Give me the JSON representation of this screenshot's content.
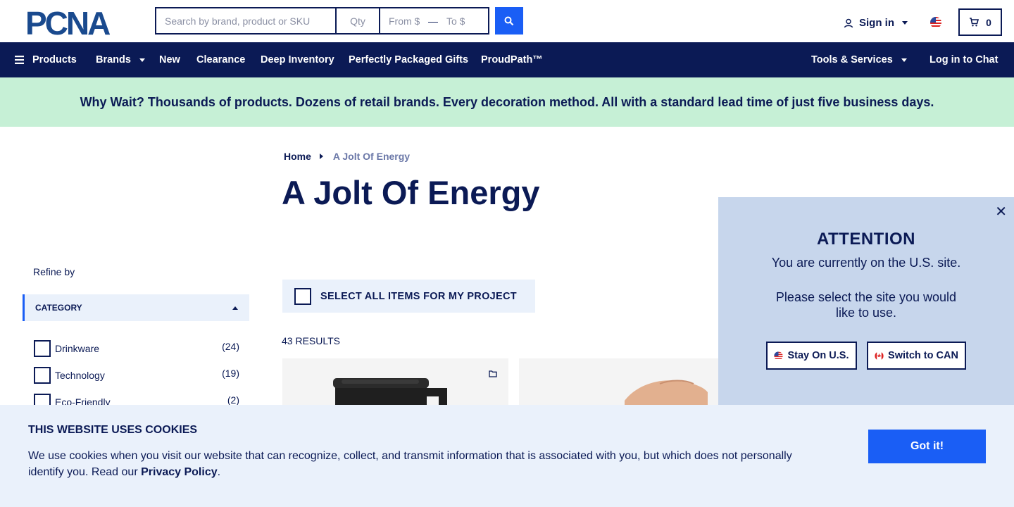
{
  "header": {
    "logo_text": "PCNA",
    "search_placeholder": "Search by brand, product or SKU",
    "qty_placeholder": "Qty",
    "from_placeholder": "From $",
    "to_placeholder": "To $",
    "signin_label": "Sign in",
    "cart_count": "0"
  },
  "nav": {
    "products": "Products",
    "brands": "Brands",
    "new": "New",
    "clearance": "Clearance",
    "deep_inventory": "Deep Inventory",
    "gifts": "Perfectly Packaged Gifts",
    "proudpath": "ProudPath™",
    "tools": "Tools & Services",
    "chat": "Log in to Chat"
  },
  "promo": "Why Wait? Thousands of products. Dozens of retail brands. Every decoration method. All with a standard lead time of just five business days.",
  "breadcrumb": {
    "home": "Home",
    "current": "A Jolt Of Energy"
  },
  "page_title": "A Jolt Of Energy",
  "sidebar": {
    "refine_label": "Refine by",
    "category_header": "CATEGORY",
    "categories": [
      {
        "label": "Drinkware",
        "count": "(24)"
      },
      {
        "label": "Technology",
        "count": "(19)"
      },
      {
        "label": "Eco-Friendly",
        "count": "(2)"
      }
    ]
  },
  "listing": {
    "select_all_label": "SELECT ALL ITEMS FOR MY PROJECT",
    "results_count": "43 RESULTS"
  },
  "attention": {
    "title": "ATTENTION",
    "line1": "You are currently on the U.S. site.",
    "line2": "Please select the site you would like to use.",
    "stay_label": "Stay On U.S.",
    "switch_label": "Switch to CAN"
  },
  "cookie": {
    "title": "THIS WEBSITE USES COOKIES",
    "text": "We use cookies when you visit our website that can recognize, collect, and transmit information that is associated with you, but which does not personally identify you. Read our ",
    "link": "Privacy Policy",
    "suffix": ".",
    "button": "Got it!"
  },
  "colors": {
    "navy": "#0b1a55",
    "accent_blue": "#1a5ef5",
    "promo_green": "#c6f0d6",
    "light_blue": "#eaf1fb",
    "modal_blue": "#c7d6ec"
  }
}
